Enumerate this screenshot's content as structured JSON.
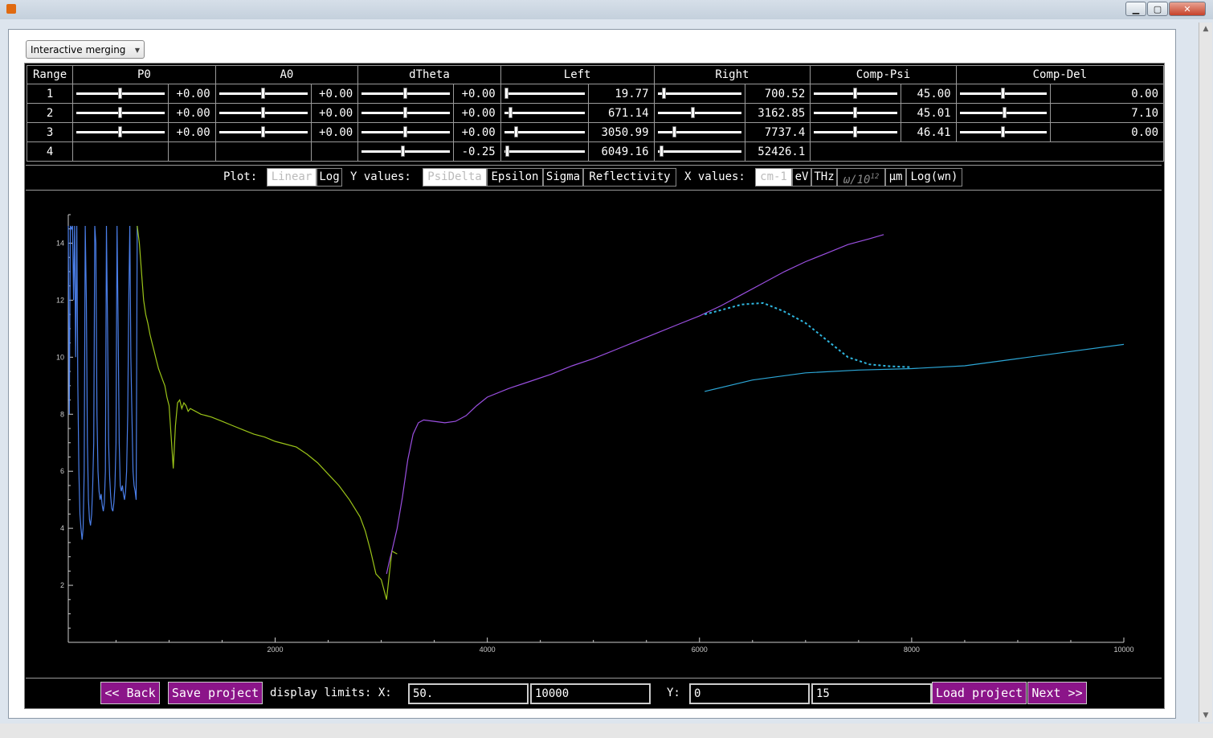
{
  "window": {
    "minimize_icon": "minimize-icon",
    "maximize_icon": "maximize-icon",
    "close_icon": "close-icon"
  },
  "mode_popup": {
    "selected": "Interactive merging"
  },
  "table": {
    "headers": [
      "Range",
      "P0",
      "A0",
      "dTheta",
      "Left",
      "Right",
      "Comp-Psi",
      "Comp-Del"
    ],
    "rows": [
      {
        "range": "1",
        "p0": "+0.00",
        "a0": "+0.00",
        "dtheta": "+0.00",
        "left": "19.77",
        "right": "700.52",
        "comp_psi": "45.00",
        "comp_del": "0.00"
      },
      {
        "range": "2",
        "p0": "+0.00",
        "a0": "+0.00",
        "dtheta": "+0.00",
        "left": "671.14",
        "right": "3162.85",
        "comp_psi": "45.01",
        "comp_del": "7.10"
      },
      {
        "range": "3",
        "p0": "+0.00",
        "a0": "+0.00",
        "dtheta": "+0.00",
        "left": "3050.99",
        "right": "7737.4",
        "comp_psi": "46.41",
        "comp_del": "0.00"
      },
      {
        "range": "4",
        "dtheta": "-0.25",
        "left": "6049.16",
        "right": "52426.1"
      }
    ],
    "sliders": {
      "row1": {
        "p0": 0.5,
        "a0": 0.5,
        "dtheta": 0.5,
        "left": 0.0,
        "right": 0.05,
        "comp_psi": 0.5,
        "comp_del": 0.5
      },
      "row2": {
        "p0": 0.5,
        "a0": 0.5,
        "dtheta": 0.5,
        "left": 0.05,
        "right": 0.42,
        "comp_psi": 0.5,
        "comp_del": 0.52
      },
      "row3": {
        "p0": 0.5,
        "a0": 0.5,
        "dtheta": 0.5,
        "left": 0.13,
        "right": 0.18,
        "comp_psi": 0.5,
        "comp_del": 0.5
      },
      "row4": {
        "dtheta": 0.47,
        "left": 0.01,
        "right": 0.02
      }
    }
  },
  "plot_controls": {
    "plot_label": "Plot:",
    "plot_options": [
      "Linear",
      "Log"
    ],
    "plot_selected": "Linear",
    "y_label": "Y values:",
    "y_options": [
      "PsiDelta",
      "Epsilon",
      "Sigma",
      "Reflectivity"
    ],
    "y_selected": "PsiDelta",
    "x_label": "X values:",
    "x_options": [
      "cm-1",
      "eV",
      "THz",
      "ω/10",
      "μm",
      "Log(wn)"
    ],
    "x_sup": "12",
    "x_selected": "cm-1"
  },
  "chart_data": {
    "type": "line",
    "xlim": [
      50,
      10000
    ],
    "ylim": [
      0,
      15
    ],
    "x_ticks": [
      "2000",
      "4000",
      "6000",
      "8000",
      "10000"
    ],
    "y_ticks": [
      "2",
      "4",
      "6",
      "8",
      "10",
      "12",
      "14"
    ],
    "series": [
      {
        "color": "#4a7ee8",
        "x": [
          50,
          60,
          70,
          80,
          90,
          100,
          110,
          120,
          130,
          140,
          150,
          160,
          170,
          180,
          190,
          200,
          210,
          220,
          230,
          240,
          250,
          260,
          270,
          280,
          290,
          300,
          310,
          320,
          330,
          340,
          350,
          360,
          370,
          380,
          390,
          400,
          410,
          420,
          430,
          440,
          450,
          460,
          470,
          480,
          490,
          500,
          510,
          520,
          530,
          540,
          550,
          560,
          570,
          580,
          590,
          600,
          610,
          620,
          630,
          640,
          650,
          660,
          670,
          680,
          690,
          700
        ],
        "y": [
          15,
          8,
          15,
          14.5,
          15,
          12,
          15,
          10,
          15,
          9,
          6,
          4.5,
          4,
          3.6,
          4,
          6,
          15,
          12,
          7,
          5,
          4.3,
          4.1,
          4.5,
          5.5,
          7,
          15,
          14,
          8,
          6,
          5.3,
          5,
          5.2,
          4.8,
          4.6,
          4.9,
          6,
          15,
          11,
          7,
          5.8,
          5.1,
          4.7,
          4.6,
          4.9,
          5.5,
          7,
          15,
          11,
          7,
          5.5,
          5.3,
          5.5,
          5.2,
          5,
          5.3,
          6,
          8,
          12,
          15,
          10,
          8,
          6,
          5.5,
          5.3,
          5,
          15
        ]
      },
      {
        "color": "#9bc418",
        "x": [
          700,
          720,
          740,
          760,
          780,
          800,
          820,
          840,
          860,
          880,
          900,
          920,
          940,
          960,
          980,
          1000,
          1020,
          1040,
          1060,
          1080,
          1100,
          1120,
          1140,
          1160,
          1180,
          1200,
          1250,
          1300,
          1350,
          1400,
          1500,
          1600,
          1700,
          1800,
          1900,
          2000,
          2100,
          2200,
          2300,
          2400,
          2500,
          2600,
          2700,
          2800,
          2850,
          2900,
          2950,
          3000,
          3050,
          3100,
          3150
        ],
        "y": [
          15,
          14,
          13,
          12,
          11.5,
          11.2,
          10.8,
          10.5,
          10.2,
          9.9,
          9.6,
          9.4,
          9.2,
          9,
          8.6,
          8.3,
          7.2,
          6.1,
          7.6,
          8.4,
          8.5,
          8.2,
          8.4,
          8.3,
          8.1,
          8.2,
          8.1,
          8,
          7.95,
          7.9,
          7.75,
          7.6,
          7.45,
          7.3,
          7.2,
          7.05,
          6.95,
          6.85,
          6.6,
          6.3,
          5.9,
          5.5,
          5,
          4.4,
          3.9,
          3.2,
          2.4,
          2.2,
          1.5,
          3.2,
          3.1
        ]
      },
      {
        "color": "#9a4fe0",
        "x": [
          3050,
          3080,
          3100,
          3150,
          3200,
          3250,
          3300,
          3350,
          3400,
          3500,
          3600,
          3700,
          3800,
          3900,
          4000,
          4200,
          4400,
          4600,
          4800,
          5000,
          5200,
          5400,
          5600,
          5800,
          6000,
          6200,
          6400,
          6600,
          6800,
          7000,
          7200,
          7400,
          7600,
          7737
        ],
        "y": [
          2.4,
          2.9,
          3.2,
          4.0,
          5.1,
          6.4,
          7.3,
          7.7,
          7.8,
          7.75,
          7.7,
          7.75,
          7.95,
          8.3,
          8.6,
          8.9,
          9.15,
          9.4,
          9.7,
          9.95,
          10.25,
          10.55,
          10.85,
          11.15,
          11.45,
          11.8,
          12.2,
          12.6,
          13,
          13.35,
          13.65,
          13.95,
          14.15,
          14.3
        ]
      },
      {
        "color": "#2fb7e0",
        "dashed": true,
        "x": [
          6049,
          6200,
          6400,
          6600,
          6800,
          7000,
          7200,
          7400,
          7600,
          7800,
          8000
        ],
        "y": [
          11.5,
          11.65,
          11.85,
          11.9,
          11.6,
          11.2,
          10.6,
          10.0,
          9.75,
          9.68,
          9.65
        ]
      },
      {
        "color": "#2ca6d6",
        "x": [
          6049,
          6500,
          7000,
          7500,
          8000,
          8500,
          9000,
          9500,
          10000
        ],
        "y": [
          8.8,
          9.2,
          9.45,
          9.55,
          9.6,
          9.7,
          9.95,
          10.2,
          10.45
        ]
      }
    ]
  },
  "bottom": {
    "back": "<< Back",
    "save": "Save project",
    "limits_label": "display limits: X:",
    "x_min": "50.",
    "x_max": "10000",
    "y_label": "Y:",
    "y_min": "0",
    "y_max": "15",
    "load": "Load project",
    "next": "Next >>"
  }
}
